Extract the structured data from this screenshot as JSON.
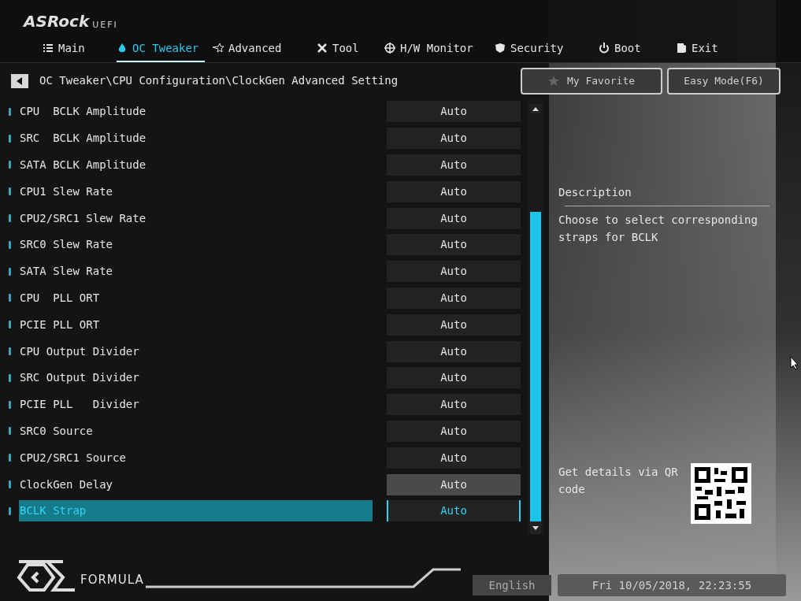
{
  "logo": {
    "brand": "ASRock",
    "suffix": "UEFI"
  },
  "tabs": [
    {
      "label": "Main",
      "selected": false
    },
    {
      "label": "OC Tweaker",
      "selected": true
    },
    {
      "label": "Advanced",
      "selected": false
    },
    {
      "label": "Tool",
      "selected": false
    },
    {
      "label": "H/W Monitor",
      "selected": false
    },
    {
      "label": "Security",
      "selected": false
    },
    {
      "label": "Boot",
      "selected": false
    },
    {
      "label": "Exit",
      "selected": false
    }
  ],
  "breadcrumb": "OC Tweaker\\CPU Configuration\\ClockGen Advanced Setting",
  "buttons": [
    {
      "label": "My Favorite",
      "kind": "favorite"
    },
    {
      "label": "Easy Mode(F6)",
      "kind": "plain"
    }
  ],
  "settings": [
    {
      "name": "CPU  BCLK Amplitude",
      "value": "Auto",
      "selected": false,
      "hovered": false
    },
    {
      "name": "SRC  BCLK Amplitude",
      "value": "Auto",
      "selected": false,
      "hovered": false
    },
    {
      "name": "SATA BCLK Amplitude",
      "value": "Auto",
      "selected": false,
      "hovered": false
    },
    {
      "name": "CPU1 Slew Rate",
      "value": "Auto",
      "selected": false,
      "hovered": false
    },
    {
      "name": "CPU2/SRC1 Slew Rate",
      "value": "Auto",
      "selected": false,
      "hovered": false
    },
    {
      "name": "SRC0 Slew Rate",
      "value": "Auto",
      "selected": false,
      "hovered": false
    },
    {
      "name": "SATA Slew Rate",
      "value": "Auto",
      "selected": false,
      "hovered": false
    },
    {
      "name": "CPU  PLL ORT",
      "value": "Auto",
      "selected": false,
      "hovered": false
    },
    {
      "name": "PCIE PLL ORT",
      "value": "Auto",
      "selected": false,
      "hovered": false
    },
    {
      "name": "CPU Output Divider",
      "value": "Auto",
      "selected": false,
      "hovered": false
    },
    {
      "name": "SRC Output Divider",
      "value": "Auto",
      "selected": false,
      "hovered": false
    },
    {
      "name": "PCIE PLL   Divider",
      "value": "Auto",
      "selected": false,
      "hovered": false
    },
    {
      "name": "SRC0 Source",
      "value": "Auto",
      "selected": false,
      "hovered": false
    },
    {
      "name": "CPU2/SRC1 Source",
      "value": "Auto",
      "selected": false,
      "hovered": false
    },
    {
      "name": "ClockGen Delay",
      "value": "Auto",
      "selected": false,
      "hovered": true
    },
    {
      "name": "BCLK Strap",
      "value": "Auto",
      "selected": true,
      "hovered": false
    }
  ],
  "description": {
    "title": "Description",
    "text": "Choose to select corresponding straps for BCLK",
    "qr_text": "Get details via QR code"
  },
  "footer": {
    "brand": "FORMULA",
    "language": "English",
    "datetime": "Fri 10/05/2018, 22:23:55"
  }
}
